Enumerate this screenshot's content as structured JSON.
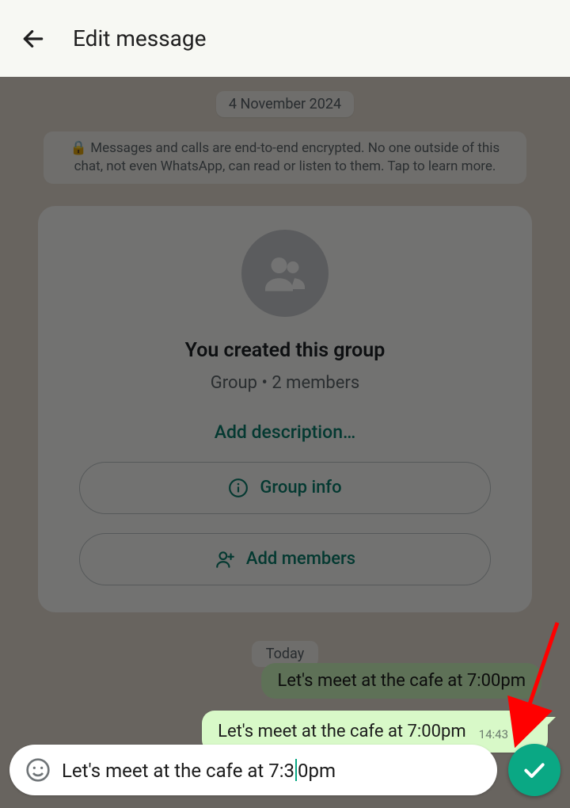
{
  "header": {
    "title": "Edit message"
  },
  "chat": {
    "date_chip": "4 November 2024",
    "encryption_notice": "Messages and calls are end-to-end encrypted. No one outside of this chat, not even WhatsApp, can read or listen to them. Tap to learn more.",
    "today_chip": "Today"
  },
  "group_card": {
    "created_label": "You created this group",
    "meta": "Group • 2 members",
    "add_description": "Add description…",
    "group_info_label": "Group info",
    "add_members_label": "Add members"
  },
  "highlighted_message": {
    "text": "Let's meet at the cafe at 7:00pm",
    "time": "14:43"
  },
  "partial_message_peek": "Let's meet at the cafe at 7:00pm",
  "editor": {
    "value_before_caret": "Let's meet at the cafe at 7:3",
    "value_after_caret": "0pm",
    "full_value": "Let's meet at the cafe at 7:30pm"
  },
  "colors": {
    "accent": "#0aa884",
    "bubble_out": "#d8f9c8"
  }
}
